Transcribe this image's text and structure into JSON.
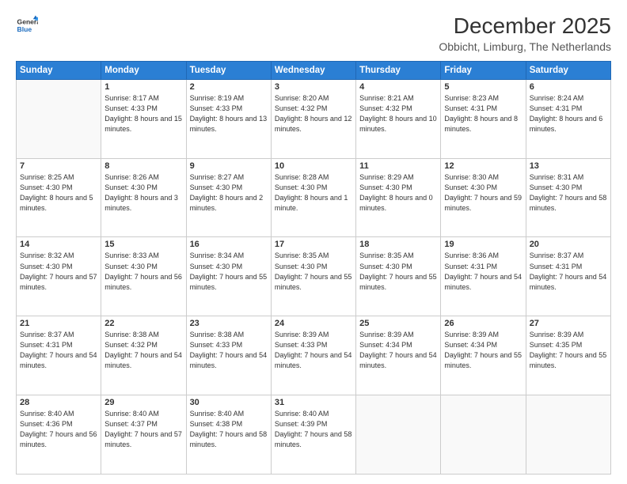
{
  "logo": {
    "line1": "General",
    "line2": "Blue"
  },
  "title": "December 2025",
  "subtitle": "Obbicht, Limburg, The Netherlands",
  "weekdays": [
    "Sunday",
    "Monday",
    "Tuesday",
    "Wednesday",
    "Thursday",
    "Friday",
    "Saturday"
  ],
  "weeks": [
    [
      {
        "day": "",
        "info": ""
      },
      {
        "day": "1",
        "info": "Sunrise: 8:17 AM\nSunset: 4:33 PM\nDaylight: 8 hours\nand 15 minutes."
      },
      {
        "day": "2",
        "info": "Sunrise: 8:19 AM\nSunset: 4:33 PM\nDaylight: 8 hours\nand 13 minutes."
      },
      {
        "day": "3",
        "info": "Sunrise: 8:20 AM\nSunset: 4:32 PM\nDaylight: 8 hours\nand 12 minutes."
      },
      {
        "day": "4",
        "info": "Sunrise: 8:21 AM\nSunset: 4:32 PM\nDaylight: 8 hours\nand 10 minutes."
      },
      {
        "day": "5",
        "info": "Sunrise: 8:23 AM\nSunset: 4:31 PM\nDaylight: 8 hours\nand 8 minutes."
      },
      {
        "day": "6",
        "info": "Sunrise: 8:24 AM\nSunset: 4:31 PM\nDaylight: 8 hours\nand 6 minutes."
      }
    ],
    [
      {
        "day": "7",
        "info": "Sunrise: 8:25 AM\nSunset: 4:30 PM\nDaylight: 8 hours\nand 5 minutes."
      },
      {
        "day": "8",
        "info": "Sunrise: 8:26 AM\nSunset: 4:30 PM\nDaylight: 8 hours\nand 3 minutes."
      },
      {
        "day": "9",
        "info": "Sunrise: 8:27 AM\nSunset: 4:30 PM\nDaylight: 8 hours\nand 2 minutes."
      },
      {
        "day": "10",
        "info": "Sunrise: 8:28 AM\nSunset: 4:30 PM\nDaylight: 8 hours\nand 1 minute."
      },
      {
        "day": "11",
        "info": "Sunrise: 8:29 AM\nSunset: 4:30 PM\nDaylight: 8 hours\nand 0 minutes."
      },
      {
        "day": "12",
        "info": "Sunrise: 8:30 AM\nSunset: 4:30 PM\nDaylight: 7 hours\nand 59 minutes."
      },
      {
        "day": "13",
        "info": "Sunrise: 8:31 AM\nSunset: 4:30 PM\nDaylight: 7 hours\nand 58 minutes."
      }
    ],
    [
      {
        "day": "14",
        "info": "Sunrise: 8:32 AM\nSunset: 4:30 PM\nDaylight: 7 hours\nand 57 minutes."
      },
      {
        "day": "15",
        "info": "Sunrise: 8:33 AM\nSunset: 4:30 PM\nDaylight: 7 hours\nand 56 minutes."
      },
      {
        "day": "16",
        "info": "Sunrise: 8:34 AM\nSunset: 4:30 PM\nDaylight: 7 hours\nand 55 minutes."
      },
      {
        "day": "17",
        "info": "Sunrise: 8:35 AM\nSunset: 4:30 PM\nDaylight: 7 hours\nand 55 minutes."
      },
      {
        "day": "18",
        "info": "Sunrise: 8:35 AM\nSunset: 4:30 PM\nDaylight: 7 hours\nand 55 minutes."
      },
      {
        "day": "19",
        "info": "Sunrise: 8:36 AM\nSunset: 4:31 PM\nDaylight: 7 hours\nand 54 minutes."
      },
      {
        "day": "20",
        "info": "Sunrise: 8:37 AM\nSunset: 4:31 PM\nDaylight: 7 hours\nand 54 minutes."
      }
    ],
    [
      {
        "day": "21",
        "info": "Sunrise: 8:37 AM\nSunset: 4:31 PM\nDaylight: 7 hours\nand 54 minutes."
      },
      {
        "day": "22",
        "info": "Sunrise: 8:38 AM\nSunset: 4:32 PM\nDaylight: 7 hours\nand 54 minutes."
      },
      {
        "day": "23",
        "info": "Sunrise: 8:38 AM\nSunset: 4:33 PM\nDaylight: 7 hours\nand 54 minutes."
      },
      {
        "day": "24",
        "info": "Sunrise: 8:39 AM\nSunset: 4:33 PM\nDaylight: 7 hours\nand 54 minutes."
      },
      {
        "day": "25",
        "info": "Sunrise: 8:39 AM\nSunset: 4:34 PM\nDaylight: 7 hours\nand 54 minutes."
      },
      {
        "day": "26",
        "info": "Sunrise: 8:39 AM\nSunset: 4:34 PM\nDaylight: 7 hours\nand 55 minutes."
      },
      {
        "day": "27",
        "info": "Sunrise: 8:39 AM\nSunset: 4:35 PM\nDaylight: 7 hours\nand 55 minutes."
      }
    ],
    [
      {
        "day": "28",
        "info": "Sunrise: 8:40 AM\nSunset: 4:36 PM\nDaylight: 7 hours\nand 56 minutes."
      },
      {
        "day": "29",
        "info": "Sunrise: 8:40 AM\nSunset: 4:37 PM\nDaylight: 7 hours\nand 57 minutes."
      },
      {
        "day": "30",
        "info": "Sunrise: 8:40 AM\nSunset: 4:38 PM\nDaylight: 7 hours\nand 58 minutes."
      },
      {
        "day": "31",
        "info": "Sunrise: 8:40 AM\nSunset: 4:39 PM\nDaylight: 7 hours\nand 58 minutes."
      },
      {
        "day": "",
        "info": ""
      },
      {
        "day": "",
        "info": ""
      },
      {
        "day": "",
        "info": ""
      }
    ]
  ]
}
